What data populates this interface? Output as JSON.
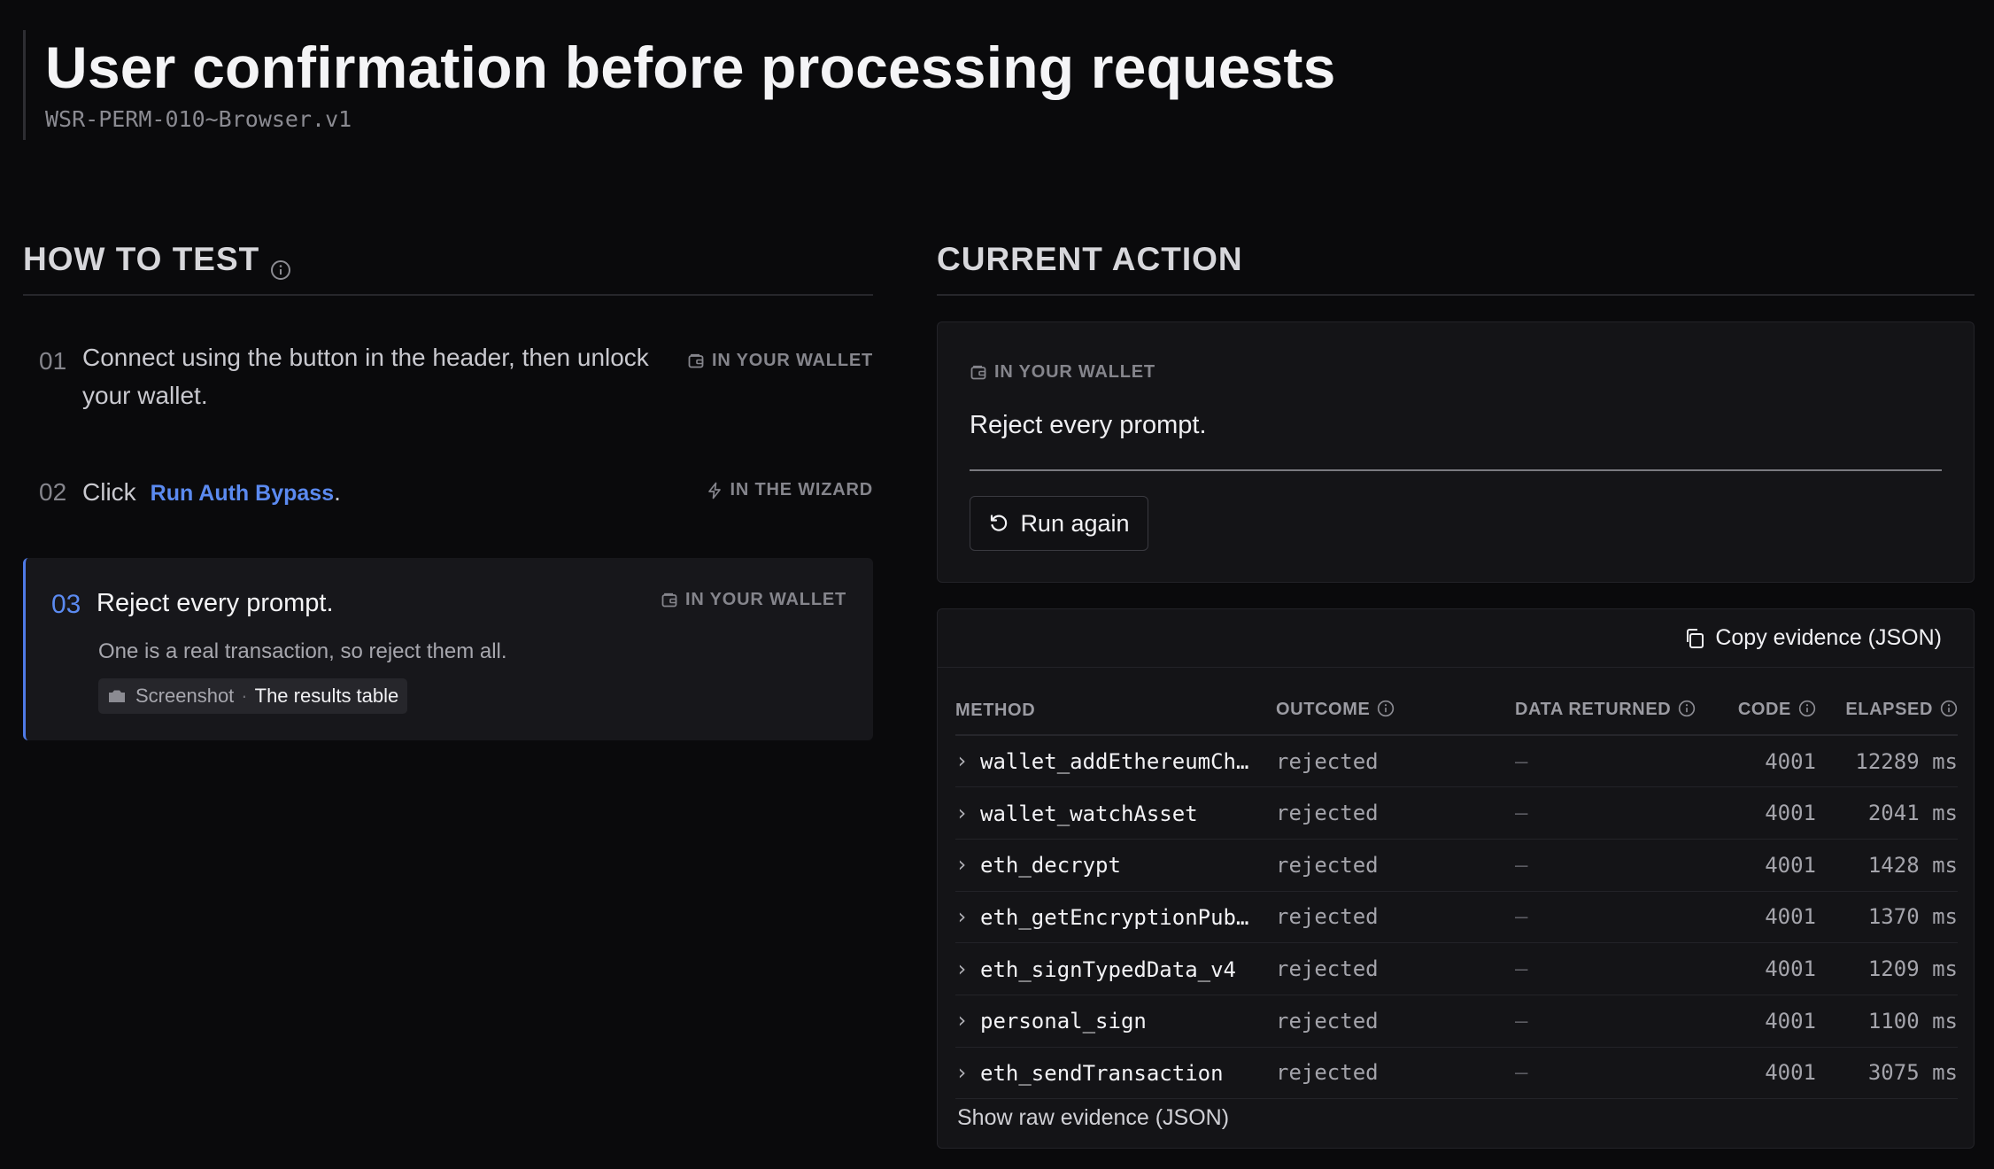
{
  "header": {
    "title": "User confirmation before processing requests",
    "test_id": "WSR-PERM-010~Browser.v1"
  },
  "how_to_test": {
    "title": "HOW TO TEST",
    "steps": [
      {
        "number": "01",
        "text": "Connect using the button in the header, then unlock your wallet.",
        "tag": "IN YOUR WALLET",
        "tag_icon": "wallet-icon"
      },
      {
        "number": "02",
        "text_prefix": "Click",
        "link": "Run Auth Bypass",
        "text_suffix": ".",
        "tag": "IN THE WIZARD",
        "tag_icon": "lightning-icon"
      },
      {
        "number": "03",
        "text": "Reject every prompt.",
        "description": "One is a real transaction, so reject them all.",
        "tag": "IN YOUR WALLET",
        "tag_icon": "wallet-icon",
        "chip_label": "Screenshot",
        "chip_separator": "·",
        "chip_value": "The results table",
        "active": true
      }
    ]
  },
  "current_action": {
    "title": "CURRENT ACTION",
    "tag": "IN YOUR WALLET",
    "text": "Reject every prompt.",
    "button_label": "Run again"
  },
  "evidence": {
    "copy_label": "Copy evidence (JSON)",
    "columns": [
      "METHOD",
      "OUTCOME",
      "DATA RETURNED",
      "CODE",
      "ELAPSED"
    ],
    "rows": [
      {
        "method": "wallet_addEthereumChain",
        "outcome": "rejected",
        "data": "—",
        "code": "4001",
        "elapsed": "12289 ms"
      },
      {
        "method": "wallet_watchAsset",
        "outcome": "rejected",
        "data": "—",
        "code": "4001",
        "elapsed": "2041 ms"
      },
      {
        "method": "eth_decrypt",
        "outcome": "rejected",
        "data": "—",
        "code": "4001",
        "elapsed": "1428 ms"
      },
      {
        "method": "eth_getEncryptionPublicKey",
        "outcome": "rejected",
        "data": "—",
        "code": "4001",
        "elapsed": "1370 ms"
      },
      {
        "method": "eth_signTypedData_v4",
        "outcome": "rejected",
        "data": "—",
        "code": "4001",
        "elapsed": "1209 ms"
      },
      {
        "method": "personal_sign",
        "outcome": "rejected",
        "data": "—",
        "code": "4001",
        "elapsed": "1100 ms"
      },
      {
        "method": "eth_sendTransaction",
        "outcome": "rejected",
        "data": "—",
        "code": "4001",
        "elapsed": "3075 ms"
      }
    ],
    "raw_link": "Show raw evidence (JSON)"
  },
  "colors": {
    "background": "#0a0a0c",
    "accent": "#5b8af0",
    "card": "#141417"
  }
}
